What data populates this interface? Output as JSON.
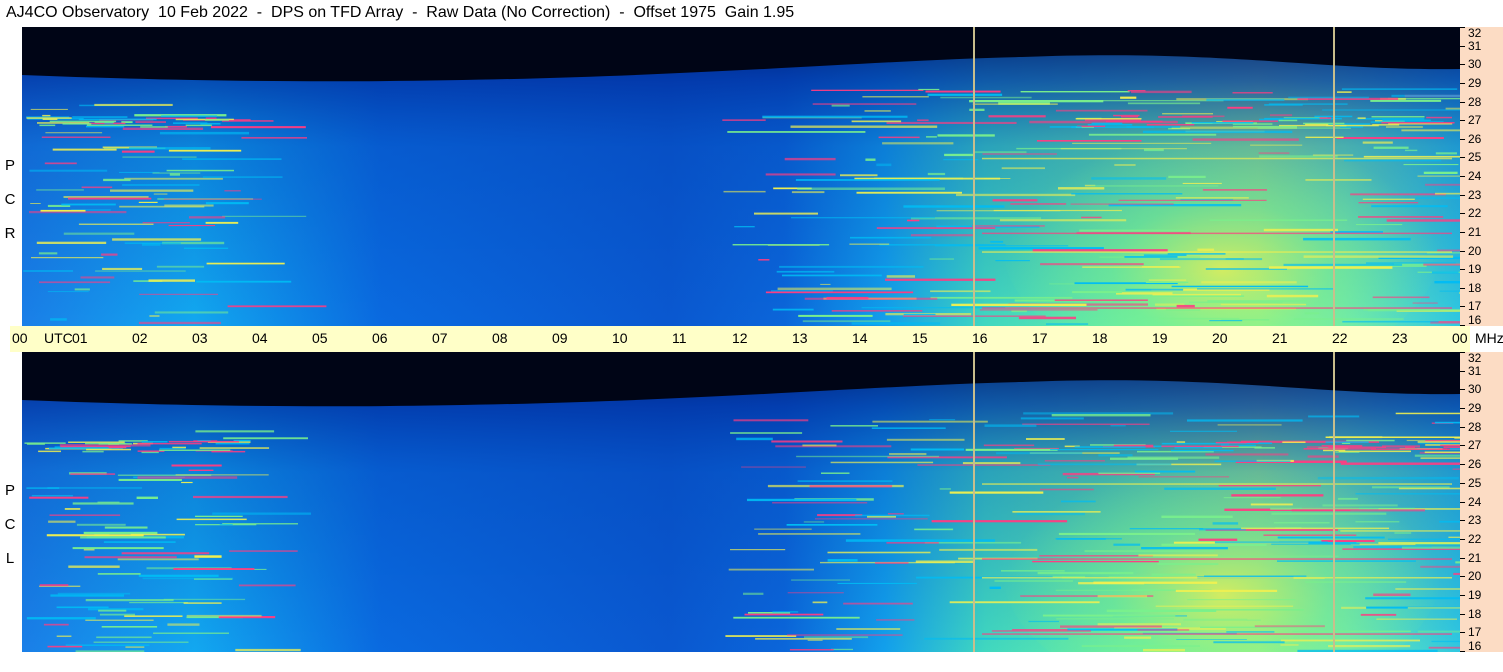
{
  "header": {
    "title": "AJ4CO Observatory  10 Feb 2022  -  DPS on TFD Array  -  Raw Data (No Correction)  -  Offset 1975  Gain 1.95"
  },
  "panels": [
    {
      "letters": [
        "R",
        "C",
        "P"
      ]
    },
    {
      "letters": [
        "L",
        "C",
        "P"
      ]
    }
  ],
  "time_axis": {
    "start_label": "00",
    "start_unit": "UTC",
    "end_label": "00",
    "end_unit": "MHz"
  },
  "chart_data": {
    "type": "heatmap",
    "title": "AJ4CO Observatory  10 Feb 2022  -  DPS on TFD Array  -  Raw Data (No Correction)  -  Offset 1975  Gain 1.95",
    "x_axis": {
      "quantity": "UTC hour",
      "range": [
        0,
        24
      ],
      "tick_labels": [
        "00",
        "01",
        "02",
        "03",
        "04",
        "05",
        "06",
        "07",
        "08",
        "09",
        "10",
        "11",
        "12",
        "13",
        "14",
        "15",
        "16",
        "17",
        "18",
        "19",
        "20",
        "21",
        "22",
        "23",
        "00"
      ]
    },
    "y_axis": {
      "unit": "MHz",
      "range": [
        16,
        32
      ],
      "tick_labels": [
        "32",
        "31",
        "30",
        "29",
        "28",
        "27",
        "26",
        "25",
        "24",
        "23",
        "22",
        "21",
        "20",
        "19",
        "18",
        "17",
        "16"
      ]
    },
    "panels": [
      "RCP",
      "LCP"
    ],
    "markers_utc_hour": [
      15.9,
      21.9
    ],
    "colors": {
      "night": "#000516",
      "background_day": "#0a55c8",
      "elevated": "#00bcf4",
      "high": "#7af08c",
      "peak": "#f0f050",
      "spike": "#ff3c82",
      "marker": "#c8be8c"
    }
  }
}
